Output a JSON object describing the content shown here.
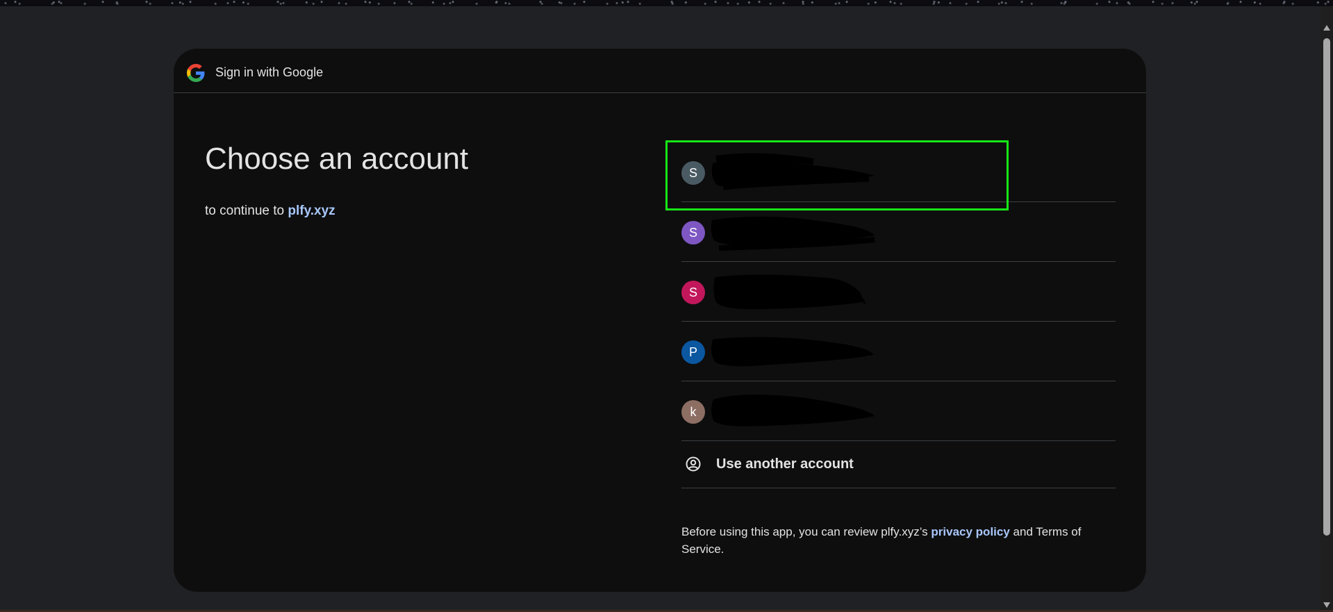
{
  "header": {
    "title": "Sign in with Google",
    "logo_icon": "google-g-logo"
  },
  "main": {
    "heading": "Choose an account",
    "subheading_prefix": "to continue to",
    "app_name": "plfy.xyz"
  },
  "accounts": [
    {
      "initial": "S",
      "color": "#4a5a63",
      "name": "",
      "email": "",
      "redacted": true,
      "highlighted": true
    },
    {
      "initial": "S",
      "color": "#7e57c2",
      "name": "",
      "email": "",
      "redacted": true,
      "highlighted": false
    },
    {
      "initial": "S",
      "color": "#c2185b",
      "name": "",
      "email": "",
      "redacted": true,
      "highlighted": false
    },
    {
      "initial": "P",
      "color": "#0b57a0",
      "name": "",
      "email": "",
      "redacted": true,
      "highlighted": false
    },
    {
      "initial": "k",
      "color": "#8d6e63",
      "name": "",
      "email": "",
      "redacted": true,
      "highlighted": false
    }
  ],
  "use_another": {
    "label": "Use another account",
    "icon": "account-circle-icon"
  },
  "footer": {
    "prefix": "Before using this app, you can review plfy.xyz’s",
    "privacy_label": "privacy policy",
    "suffix": "and Terms of Service."
  },
  "colors": {
    "background": "#202124",
    "card": "#0e0e0e",
    "link": "#a8c7fa",
    "highlight": "#17e617",
    "divider": "#3c4043"
  }
}
